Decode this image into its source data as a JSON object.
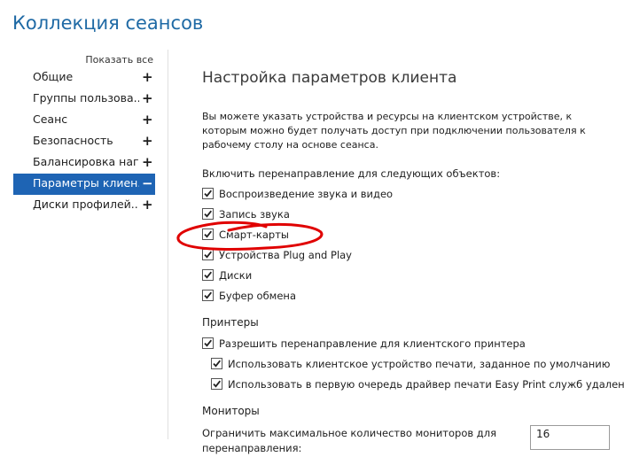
{
  "window_title": "Коллекция сеансов",
  "show_all": "Показать все",
  "nav": [
    {
      "label": "Общие",
      "sign": "+"
    },
    {
      "label": "Группы пользова...",
      "sign": "+"
    },
    {
      "label": "Сеанс",
      "sign": "+"
    },
    {
      "label": "Безопасность",
      "sign": "+"
    },
    {
      "label": "Балансировка наг...",
      "sign": "+"
    },
    {
      "label": "Параметры клиен...",
      "sign": "−"
    },
    {
      "label": "Диски профилей...",
      "sign": "+"
    }
  ],
  "section_title": "Настройка параметров клиента",
  "description": "Вы можете указать устройства и ресурсы на клиентском устройстве, к которым можно будет получать доступ при подключении пользователя к рабочему столу на основе сеанса.",
  "redirect_heading": "Включить перенаправление для следующих объектов:",
  "redirect_items": [
    {
      "label": "Воспроизведение звука и видео",
      "checked": true
    },
    {
      "label": "Запись звука",
      "checked": true
    },
    {
      "label": "Смарт-карты",
      "checked": true
    },
    {
      "label": "Устройства Plug and Play",
      "checked": true
    },
    {
      "label": "Диски",
      "checked": true
    },
    {
      "label": "Буфер обмена",
      "checked": true
    }
  ],
  "printers_heading": "Принтеры",
  "printer_items": [
    {
      "label": "Разрешить перенаправление для клиентского принтера",
      "checked": true
    },
    {
      "label": "Использовать клиентское устройство печати, заданное по умолчанию",
      "checked": true
    },
    {
      "label": "Использовать в первую очередь драйвер печати Easy Print служб удаленных р",
      "checked": true
    }
  ],
  "monitors_heading": "Мониторы",
  "monitors_label": "Ограничить максимальное количество мониторов для перенаправления:",
  "monitors_value": "16",
  "colors": {
    "accent": "#1e64b4",
    "title": "#1f6aa5",
    "annotation": "#e00000"
  }
}
